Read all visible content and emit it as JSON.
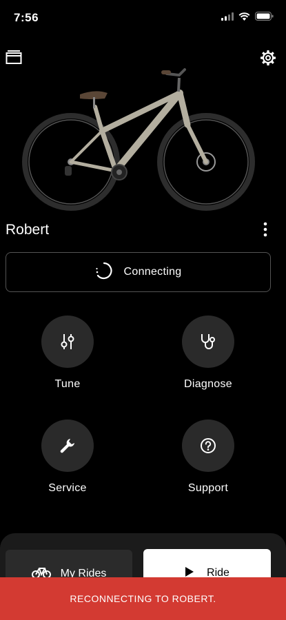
{
  "status_bar": {
    "time": "7:56",
    "icons": [
      "signal-icon",
      "wifi-icon",
      "battery-icon"
    ]
  },
  "header": {
    "left_icon": "window-icon",
    "right_icon": "gear-icon"
  },
  "bike": {
    "name": "Robert",
    "frame_color": "#b3ae9f"
  },
  "connection": {
    "label": "Connecting"
  },
  "actions": [
    {
      "label": "Tune",
      "icon": "sliders-icon"
    },
    {
      "label": "Diagnose",
      "icon": "stethoscope-icon"
    },
    {
      "label": "Service",
      "icon": "wrench-icon"
    },
    {
      "label": "Support",
      "icon": "question-icon"
    }
  ],
  "bottom": {
    "my_rides_label": "My Rides",
    "ride_label": "Ride"
  },
  "toast": {
    "message": "RECONNECTING TO ROBERT."
  },
  "colors": {
    "background": "#000000",
    "action_circle": "#2a2a2a",
    "toast": "#d33a32",
    "ride_button": "#ffffff"
  }
}
